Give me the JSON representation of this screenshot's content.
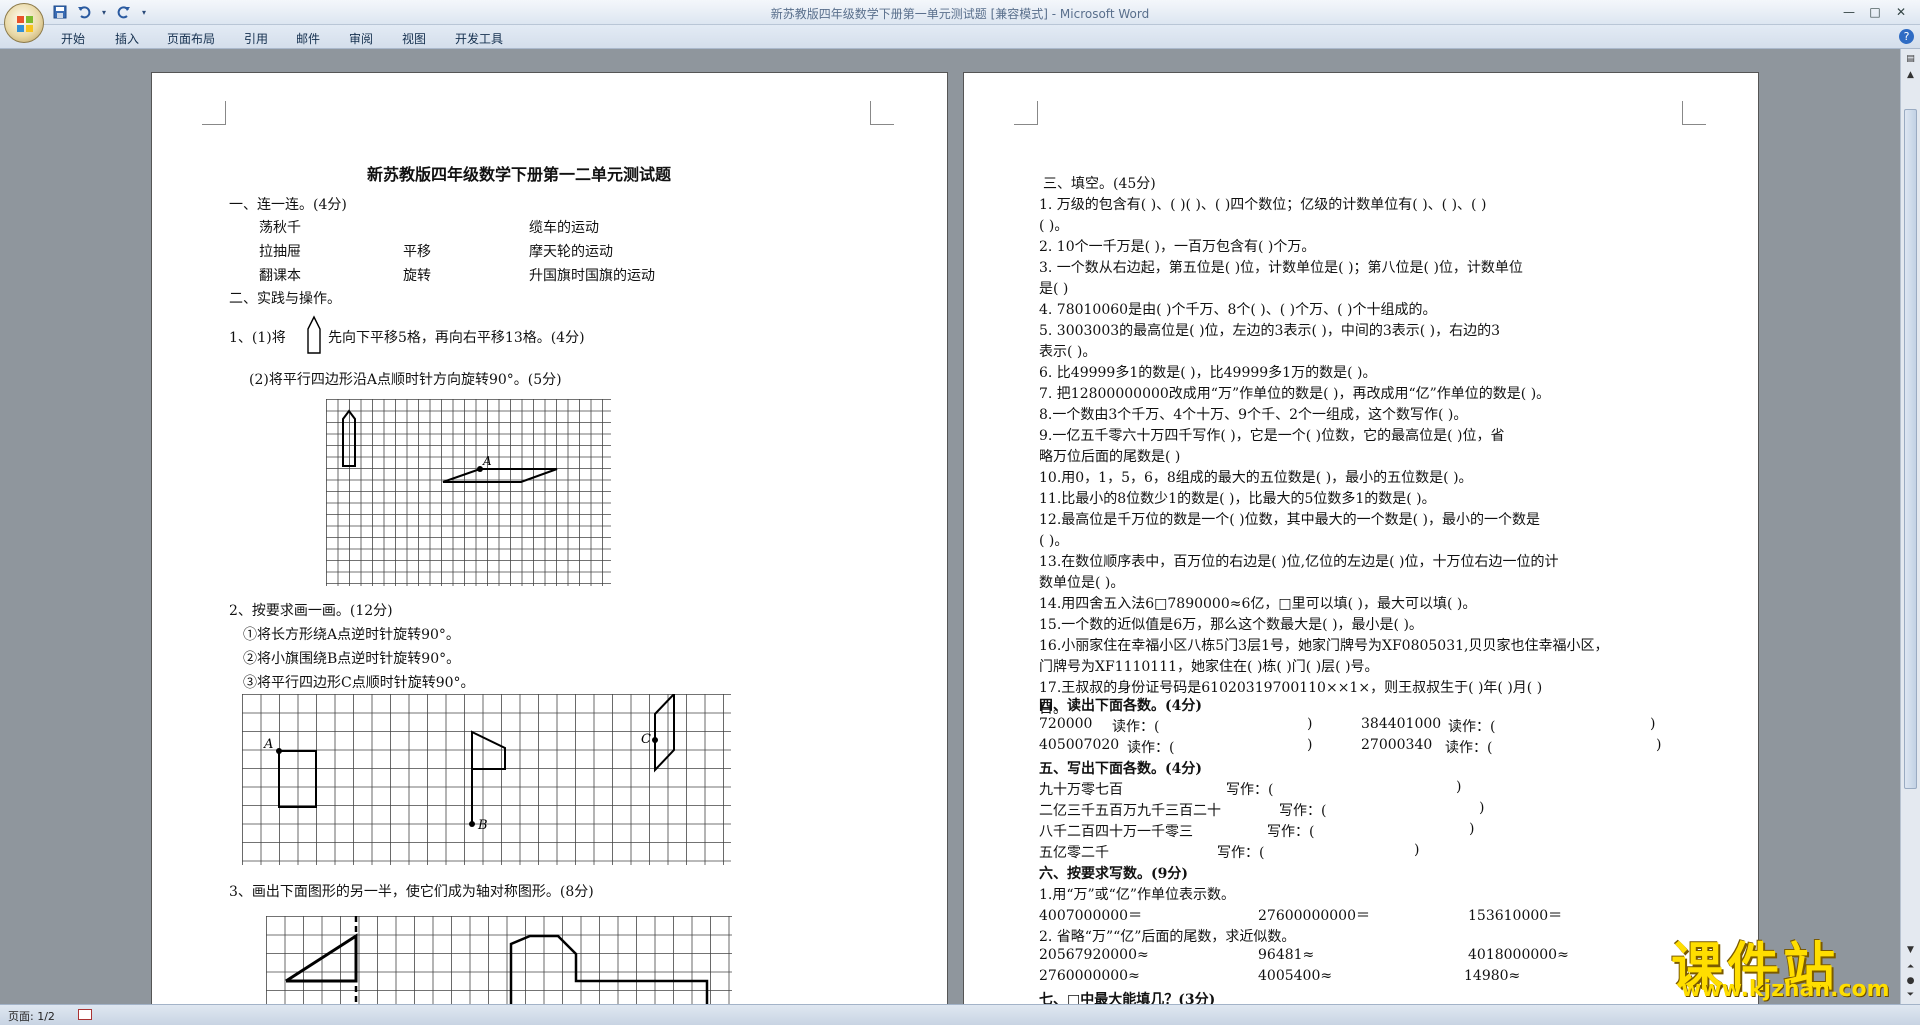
{
  "window": {
    "title": "新苏教版四年级数学下册第一单元测试题 [兼容模式] - Microsoft Word"
  },
  "ribbon": {
    "tabs": [
      "开始",
      "插入",
      "页面布局",
      "引用",
      "邮件",
      "审阅",
      "视图",
      "开发工具"
    ]
  },
  "status": {
    "page": "页面: 1/2"
  },
  "watermark": {
    "cn": "课件站",
    "url": "www.kjzhan.com"
  },
  "page1": {
    "title": "新苏教版四年级数学下册第一二单元测试题",
    "s1": "一、连一连。(4分)",
    "match": {
      "left": [
        "荡秋千",
        "拉抽屉",
        "翻课本"
      ],
      "mid": [
        "",
        "平移",
        "旋转"
      ],
      "right": [
        "缆车的运动",
        "摩天轮的运动",
        "升国旗时国旗的运动"
      ]
    },
    "s2": "二、实践与操作。",
    "q1a_prefix": "1、(1)将",
    "q1a_suffix": "先向下平移5格，再向右平移13格。(4分)",
    "q1b": "(2)将平行四边形沿A点顺时针方向旋转90°。(5分)",
    "g1_label_a": "A",
    "q2": "2、按要求画一画。(12分)",
    "q2_items": [
      "①将长方形绕A点逆时针旋转90°。",
      "②将小旗围绕B点逆时针旋转90°。",
      "③将平行四边形C点顺时针旋转90°。"
    ],
    "g2_labels": [
      "A",
      "B",
      "C"
    ],
    "q3": "3、画出下面图形的另一半，使它们成为轴对称图形。(8分)"
  },
  "page2": {
    "lines": [
      "三、填空。(45分)",
      "1. 万级的包含有(    )、(    )(    )、(    )四个数位；亿级的计数单位有(    )、(    )、(    )",
      "(    )。",
      "2.  10个一千万是(    )，一百万包含有(    )个万。",
      "3. 一个数从右边起，第五位是(    )位，计数单位是(    )；第八位是(    )位，计数单位",
      "是(    )",
      "4.  78010060是由(    )个千万、8个(    )、(    )个万、(    )个十组成的。",
      "5.  3003003的最高位是(    )位，左边的3表示(      )，中间的3表示(      )，右边的3",
      "表示(      )。",
      "6. 比49999多1的数是(      )，比49999多1万的数是(      )。",
      "7. 把12800000000改成用“万”作单位的数是(        )，再改成用“亿”作单位的数是(        )。",
      "8.一个数由3个千万、4个十万、9个千、2个一组成，这个数写作(        )。",
      "9.一亿五千零六十万四千写作(        )，它是一个(    )位数，它的最高位是(    )位，省",
      "略万位后面的尾数是(        )",
      "10.用0，1，5，6，8组成的最大的五位数是(      )，最小的五位数是(      )。",
      "11.比最小的8位数少1的数是(      )，比最大的5位数多1的数是(      )。",
      "12.最高位是千万位的数是一个(    )位数，其中最大的一个数是(      )，最小的一个数是",
      "(      )。",
      "13.在数位顺序表中，百万位的右边是(    )位,亿位的左边是(    )位，十万位右边一位的计",
      "数单位是(    )。",
      "14.用四舍五入法6□7890000≈6亿，□里可以填(      )，最大可以填(    )。",
      "15.一个数的近似值是6万，那么这个数最大是(      )，最小是(      )。",
      "16.小丽家住在幸福小区八栋5门3层1号，她家门牌号为XF0805031,贝贝家也住幸福小区，",
      "门牌号为XF1110111，她家住在(    )栋(    )门(    )层(    )号。",
      "17.王叔叔的身份证号码是61020319700110××1×，则王叔叔生于(    )年(    )月(    )",
      "日。",
      "四、读出下面各数。(4分)"
    ],
    "read": [
      [
        "720000",
        "读作：(",
        ")",
        "384401000",
        "读作：(",
        ")"
      ],
      [
        "405007020",
        "读作：(",
        ")",
        "27000340",
        "读作：(",
        ")"
      ]
    ],
    "s5": "五、写出下面各数。(4分)",
    "write": [
      [
        "九十万零七百",
        "写作：(",
        ")"
      ],
      [
        "二亿三千五百万九千三百二十",
        "写作：(",
        ")"
      ],
      [
        "八千二百四十万一千零三",
        "写作：(",
        ")"
      ],
      [
        "五亿零二千",
        "写作：(",
        ")"
      ]
    ],
    "s6": "六、按要求写数。(9分)",
    "s6_1": "1.用“万”或“亿”作单位表示数。",
    "conv1": [
      "4007000000＝",
      "27600000000＝",
      "153610000＝"
    ],
    "s6_2": "2. 省略“万”“亿”后面的尾数，求近似数。",
    "conv2a": [
      "20567920000≈",
      "96481≈",
      "4018000000≈"
    ],
    "conv2b": [
      "2760000000≈",
      "4005400≈",
      "14980≈"
    ],
    "s7": "七、□中最大能填几？(3分)"
  }
}
